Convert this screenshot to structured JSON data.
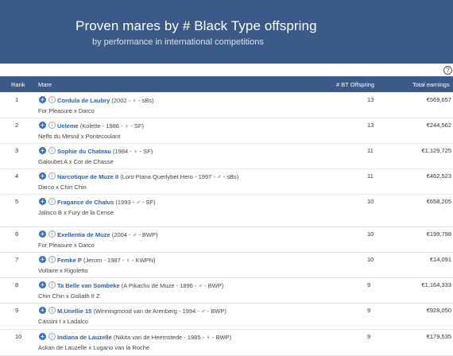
{
  "banner": {
    "title": "Proven mares by # Black Type offspring",
    "subtitle": "by performance in international competitions"
  },
  "help_icon": "?",
  "table": {
    "headers": {
      "rank": "Rank",
      "mare": "Mare",
      "bt": "# BT Offspring",
      "earnings": "Total earnings"
    },
    "rows": [
      {
        "rank": "1",
        "name": "Cordula de Laubry",
        "meta": "(2002 - ♀ - sBs)",
        "pedigree": "For Pleasure x Darco",
        "bt": "13",
        "earnings": "€569,657"
      },
      {
        "rank": "2",
        "name": "Ueleme",
        "meta": "(Kolette - 1986 - ♀ - SF)",
        "pedigree": "Nelfo du Mesnil x Pontecoulant",
        "bt": "13",
        "earnings": "€244,562"
      },
      {
        "rank": "3",
        "name": "Sophie du Chateau",
        "meta": "(1984 - ♀ - SF)",
        "pedigree": "Galoubet A x Cor de Chasse",
        "bt": "11",
        "earnings": "€1,129,725"
      },
      {
        "rank": "4",
        "name": "Narcotique de Muze II",
        "meta": "(Loro Piana Querlybet Hero - 1997 - ♂ - sBs)",
        "pedigree": "Darco x Chin Chin",
        "bt": "11",
        "earnings": "€462,523"
      },
      {
        "rank": "5",
        "name": "Fragance de Chalus",
        "meta": "(1993 - ♂ - SF)",
        "pedigree": "Jalisco B x Fury de la Cense",
        "bt": "10",
        "earnings": "€658,205"
      },
      {
        "rank": "6",
        "name": "Exellentia de Muze",
        "meta": "(2004 - ♂ - BWP)",
        "pedigree": "For Pleasure x Darco",
        "bt": "10",
        "earnings": "€199,798"
      },
      {
        "rank": "7",
        "name": "Femke P",
        "meta": "(Jerom - 1987 - ♀ - KWPN)",
        "pedigree": "Voltaire x Rigoletto",
        "bt": "10",
        "earnings": "€14,091"
      },
      {
        "rank": "8",
        "name": "Ta Belle van Sombeke",
        "meta": "(A Pikachu de Muze - 1996 - ♂ - BWP)",
        "pedigree": "Chin Chin x Goliath II Z",
        "bt": "9",
        "earnings": "€1,164,333"
      },
      {
        "rank": "9",
        "name": "M.Unellie 15",
        "meta": "(Winningmood van de Arenberg - 1994 - ♂ - BWP)",
        "pedigree": "Cassini I x Ladalco",
        "bt": "9",
        "earnings": "€928,050"
      },
      {
        "rank": "10",
        "name": "Indiana de Lauzelle",
        "meta": "(Nikita van de Heemstede - 1985 - ♀ - BWP)",
        "pedigree": "Askan de Lauzelle x Lugano van la Roche",
        "bt": "9",
        "earnings": "€179,535"
      }
    ]
  },
  "colors": {
    "header_bg": "#3b5a87",
    "link": "#2a5fa8",
    "plus_icon": "#3b6fb6"
  }
}
